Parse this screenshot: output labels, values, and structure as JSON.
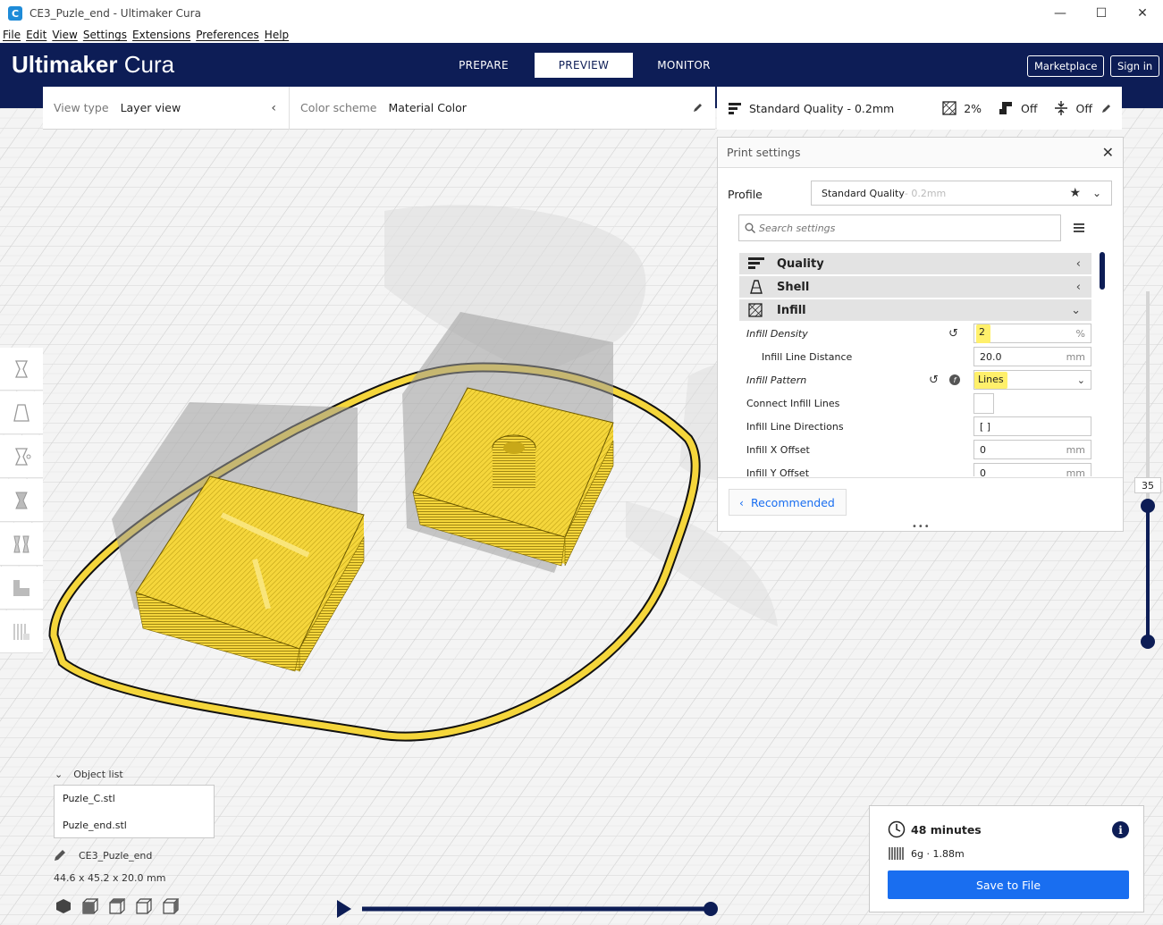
{
  "window": {
    "title": "CE3_Puzle_end - Ultimaker Cura",
    "controls": [
      "minimize",
      "maximize",
      "close"
    ]
  },
  "menu": [
    "File",
    "Edit",
    "View",
    "Settings",
    "Extensions",
    "Preferences",
    "Help"
  ],
  "header": {
    "brand_bold": "Ultimaker",
    "brand_light": " Cura",
    "stages": [
      {
        "label": "PREPARE"
      },
      {
        "label": "PREVIEW"
      },
      {
        "label": "MONITOR"
      }
    ],
    "active_stage": "PREVIEW",
    "marketplace_label": "Marketplace",
    "signin_label": "Sign in"
  },
  "view_panel": {
    "view_type_label": "View type",
    "view_type_value": "Layer view",
    "color_scheme_label": "Color scheme",
    "color_scheme_value": "Material Color"
  },
  "print_summary_bar": {
    "profile": "Standard Quality - 0.2mm",
    "infill": "2%",
    "support": "Off",
    "adhesion": "Off"
  },
  "print_settings": {
    "title": "Print settings",
    "profile_label": "Profile",
    "profile_name": "Standard Quality",
    "profile_suffix": " - 0.2mm",
    "search_placeholder": "Search settings",
    "categories": [
      {
        "label": "Quality",
        "expanded": false
      },
      {
        "label": "Shell",
        "expanded": false
      },
      {
        "label": "Infill",
        "expanded": true
      }
    ],
    "settings": {
      "infill_density": {
        "label": "Infill Density",
        "value": "2",
        "unit": "%"
      },
      "infill_line_distance": {
        "label": "Infill Line Distance",
        "value": "20.0",
        "unit": "mm"
      },
      "infill_pattern": {
        "label": "Infill Pattern",
        "value": "Lines"
      },
      "connect_infill_lines": {
        "label": "Connect Infill Lines"
      },
      "infill_line_directions": {
        "label": "Infill Line Directions",
        "value": "[ ]"
      },
      "infill_x_offset": {
        "label": "Infill X Offset",
        "value": "0",
        "unit": "mm"
      },
      "infill_y_offset": {
        "label": "Infill Y Offset",
        "value": "0",
        "unit": "mm"
      }
    },
    "recommended_label": "Recommended"
  },
  "layer_slider": {
    "current_layer": "35"
  },
  "object_list": {
    "title": "Object list",
    "items": [
      "Puzle_C.stl",
      "Puzle_end.stl"
    ],
    "project_name": "CE3_Puzle_end",
    "dimensions": "44.6 x 45.2 x 20.0 mm"
  },
  "job_summary": {
    "time": "48 minutes",
    "material": "6g · 1.88m",
    "save_label": "Save to File"
  },
  "colors": {
    "header": "#0d1d56",
    "accent": "#196ef0",
    "highlight": "#fff06b",
    "model_yellow": "#f5d63b"
  }
}
